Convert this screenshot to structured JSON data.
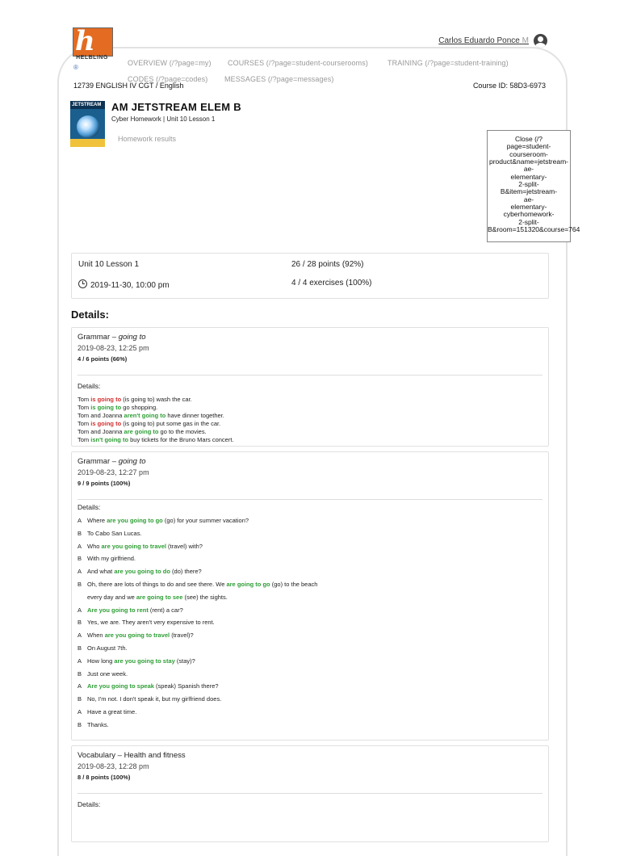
{
  "brand": {
    "logo_letter": "h",
    "logo_word": "HELBLING",
    "registered": "®"
  },
  "user": {
    "name": "Carlos Eduardo Ponce",
    "suffix": "M"
  },
  "nav": [
    "OVERVIEW (/?page=my)",
    "COURSES (/?page=student-courserooms)",
    "TRAINING (/?page=student-training)",
    "CODES (/?page=codes)",
    "MESSAGES (/?page=messages)"
  ],
  "breadcrumb": "12739 ENGLISH IV CGT / English",
  "course_id": "Course ID: 58D3-6973",
  "cover_text": "JETSTREAM",
  "title": "AM JETSTREAM ELEM B",
  "subtitle": "Cyber Homework | Unit 10 Lesson 1",
  "homework_results": "Homework results",
  "close_link": "Close (/?\npage=student-\ncourseroom-\nproduct&name=jetstream-\nae-\nelementary-\n2-split-\nB&item=jetstream-\nae-\nelementary-\ncyberhomework-\n2-split-\nB&room=151320&course=764",
  "summary": {
    "lesson": "Unit 10 Lesson 1",
    "points": "26 / 28 points (92%)",
    "due": "2019-11-30, 10:00 pm",
    "exercises": "4 / 4 exercises (100%)"
  },
  "details_heading": "Details:",
  "cards": [
    {
      "title_prefix": "Grammar – ",
      "title_em": "going to",
      "date": "2019-08-23, 12:25 pm",
      "points": "4 / 6 points (66%)",
      "details_label": "Details:",
      "lines": [
        {
          "spk": "",
          "a": "Tom ",
          "ans": "is going to",
          "st": "red",
          "b": " (is going to) wash the car."
        },
        {
          "spk": "",
          "a": "Tom ",
          "ans": "is going to",
          "st": "grn",
          "b": " go shopping."
        },
        {
          "spk": "",
          "a": "Tom and Joanna ",
          "ans": "aren't going to",
          "st": "grn",
          "b": " have dinner together."
        },
        {
          "spk": "",
          "a": "Tom ",
          "ans": "is going to",
          "st": "red",
          "b": " (is going to) put some gas in the car."
        },
        {
          "spk": "",
          "a": "Tom and Joanna ",
          "ans": "are going to",
          "st": "grn",
          "b": " go to the movies."
        },
        {
          "spk": "",
          "a": "Tom ",
          "ans": "isn't going to",
          "st": "grn",
          "b": " buy tickets for the Bruno Mars concert."
        }
      ]
    },
    {
      "title_prefix": "Grammar – ",
      "title_em": "going to",
      "date": "2019-08-23, 12:27 pm",
      "points": "9 / 9 points (100%)",
      "details_label": "Details:",
      "lines": [
        {
          "spk": "A",
          "a": "Where ",
          "ans": "are you going to go",
          "st": "grn",
          "b": " (go) for your summer vacation?"
        },
        {
          "spk": "B",
          "a": "To Cabo San Lucas.",
          "ans": "",
          "st": "",
          "b": ""
        },
        {
          "spk": "A",
          "a": "Who ",
          "ans": "are you going to travel",
          "st": "grn",
          "b": " (travel) with?"
        },
        {
          "spk": "B",
          "a": "With my girlfriend.",
          "ans": "",
          "st": "",
          "b": ""
        },
        {
          "spk": "A",
          "a": "And what ",
          "ans": "are you going to do",
          "st": "grn",
          "b": " (do) there?"
        },
        {
          "spk": "B",
          "a": "Oh, there are lots of things to do and see there. We ",
          "ans": "are going to go",
          "st": "grn",
          "b": " (go) to the beach"
        },
        {
          "spk": "",
          "a": "every day and we ",
          "ans": "are going to see",
          "st": "grn",
          "b": " (see) the sights."
        },
        {
          "spk": "A",
          "a": "",
          "ans": "Are you going to rent",
          "st": "grn",
          "b": " (rent) a car?"
        },
        {
          "spk": "B",
          "a": "Yes, we are. They aren't very expensive to rent.",
          "ans": "",
          "st": "",
          "b": ""
        },
        {
          "spk": "A",
          "a": "When ",
          "ans": "are you going to travel",
          "st": "grn",
          "b": " (travel)?"
        },
        {
          "spk": "B",
          "a": "On August 7th.",
          "ans": "",
          "st": "",
          "b": ""
        },
        {
          "spk": "A",
          "a": "How long ",
          "ans": "are you going to stay",
          "st": "grn",
          "b": " (stay)?"
        },
        {
          "spk": "B",
          "a": "Just one week.",
          "ans": "",
          "st": "",
          "b": ""
        },
        {
          "spk": "A",
          "a": "",
          "ans": "Are you going to speak",
          "st": "grn",
          "b": " (speak) Spanish there?"
        },
        {
          "spk": "B",
          "a": "No, I'm not. I don't speak it, but my girlfriend does.",
          "ans": "",
          "st": "",
          "b": ""
        },
        {
          "spk": "A",
          "a": "Have a great time.",
          "ans": "",
          "st": "",
          "b": ""
        },
        {
          "spk": "B",
          "a": "Thanks.",
          "ans": "",
          "st": "",
          "b": ""
        }
      ]
    },
    {
      "title_prefix": "Vocabulary – Health and fitness",
      "title_em": "",
      "date": "2019-08-23, 12:28 pm",
      "points": "8 / 8 points (100%)",
      "details_label": "Details:",
      "lines": []
    }
  ]
}
